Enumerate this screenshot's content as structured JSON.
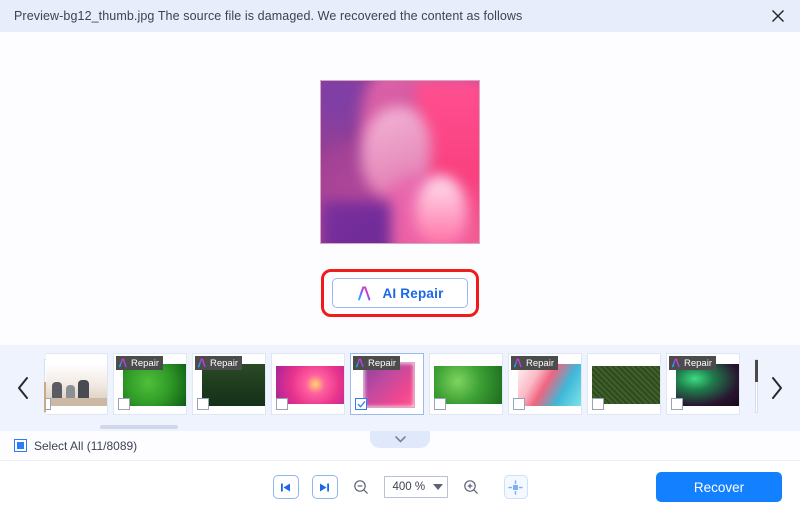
{
  "header": {
    "message": "Preview-bg12_thumb.jpg The source file is damaged. We recovered the content as follows",
    "close_label": "✕",
    "background": "#e7edfb"
  },
  "preview": {
    "alt": "Recovered photo preview — blurred pink and purple flower petals",
    "border_color": "#d9a8c0"
  },
  "repair": {
    "label": "AI Repair",
    "icon": "ai-logo-icon",
    "highlight_color": "#f01c1c",
    "text_color": "#1a68e8"
  },
  "strip": {
    "prev_label": "‹",
    "next_label": "›",
    "badge_label": "Repair",
    "collapse_icon": "chevron-down-icon",
    "thumbnails": [
      {
        "name": "family-at-table",
        "repaired": false,
        "checked": false,
        "wide": false
      },
      {
        "name": "green-leaves-macro",
        "repaired": true,
        "checked": false,
        "wide": false
      },
      {
        "name": "pine-forest",
        "repaired": true,
        "checked": false,
        "wide": false
      },
      {
        "name": "pink-dahlia-flower",
        "repaired": false,
        "checked": false,
        "wide": true
      },
      {
        "name": "pink-petals-closeup",
        "repaired": true,
        "checked": true,
        "wide": false
      },
      {
        "name": "clover-ground-cover",
        "repaired": false,
        "checked": false,
        "wide": true
      },
      {
        "name": "abstract-gradient-wave",
        "repaired": true,
        "checked": false,
        "wide": false
      },
      {
        "name": "dense-treetops",
        "repaired": false,
        "checked": false,
        "wide": true
      },
      {
        "name": "aurora-night-sky",
        "repaired": true,
        "checked": false,
        "wide": false
      }
    ]
  },
  "select_all": {
    "label": "Select All (11/8089)",
    "state": "indeterminate",
    "accent": "#2f7df5"
  },
  "toolbar": {
    "prev_page_icon": "skip-previous-icon",
    "next_page_icon": "skip-next-icon",
    "zoom_out_icon": "zoom-out-icon",
    "zoom_in_icon": "zoom-in-icon",
    "zoom_value": "400 %",
    "fit_icon": "fit-to-screen-icon",
    "recover_label": "Recover",
    "recover_color": "#1380ff"
  }
}
